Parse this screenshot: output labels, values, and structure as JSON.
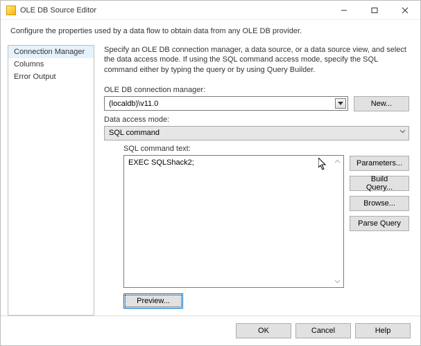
{
  "window": {
    "title": "OLE DB Source Editor"
  },
  "description": "Configure the properties used by a data flow to obtain data from any OLE DB provider.",
  "sidebar": {
    "items": [
      {
        "label": "Connection Manager"
      },
      {
        "label": "Columns"
      },
      {
        "label": "Error Output"
      }
    ]
  },
  "hint": "Specify an OLE DB connection manager, a data source, or a data source view, and select the data access mode. If using the SQL command access mode, specify the SQL command either by typing the query or by using Query Builder.",
  "conn": {
    "label": "OLE DB connection manager:",
    "value": "(localdb)\\v11.0",
    "new_btn": "New..."
  },
  "mode": {
    "label": "Data access mode:",
    "value": "SQL command"
  },
  "sql": {
    "label": "SQL command text:",
    "value": "EXEC SQLShack2;"
  },
  "side_buttons": {
    "parameters": "Parameters...",
    "build": "Build Query...",
    "browse": "Browse...",
    "parse": "Parse Query"
  },
  "preview_btn": "Preview...",
  "footer": {
    "ok": "OK",
    "cancel": "Cancel",
    "help": "Help"
  }
}
